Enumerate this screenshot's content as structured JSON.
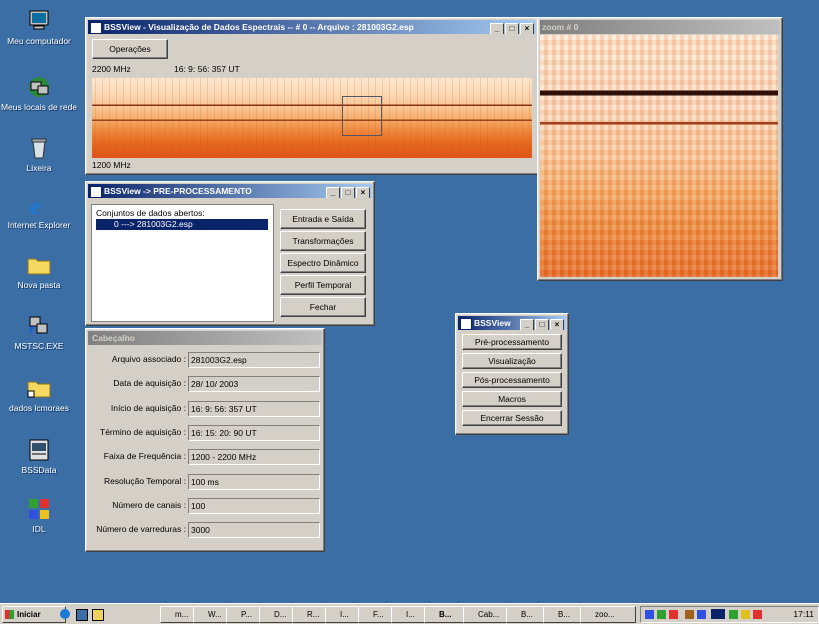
{
  "desktop": {
    "icons": [
      {
        "label": "Meu computador",
        "icon": "my-computer-icon"
      },
      {
        "label": "Meus locais de rede",
        "icon": "network-places-icon"
      },
      {
        "label": "Lixeira",
        "icon": "recycle-bin-icon"
      },
      {
        "label": "Internet Explorer",
        "icon": "internet-explorer-icon"
      },
      {
        "label": "Nova pasta",
        "icon": "folder-icon"
      },
      {
        "label": "MSTSC.EXE",
        "icon": "mstsc-icon"
      },
      {
        "label": "dados lcmoraes",
        "icon": "folder-shortcut-icon"
      },
      {
        "label": "BSSData",
        "icon": "bssdata-icon"
      },
      {
        "label": "IDL",
        "icon": "idl-icon"
      }
    ]
  },
  "main_window": {
    "title": "BSSView - Visualização de Dados Espectrais -- # 0  --  Arquivo : 281003G2.esp",
    "operations_label": "Operações",
    "freq_top": "2200 MHz",
    "time_label": "16: 9: 56: 357 UT",
    "freq_bottom": "1200 MHz"
  },
  "zoom_window": {
    "title": "zoom # 0"
  },
  "pre_window": {
    "title": "BSSView -> PRE-PROCESSAMENTO",
    "list_label": "Conjuntos de dados abertos:",
    "list_items": [
      "0 ---> 281003G2.esp"
    ],
    "buttons": [
      "Entrada e Saída",
      "Transformações",
      "Espectro Dinâmico",
      "Perfil Temporal",
      "Fechar"
    ]
  },
  "header_window": {
    "title": "Cabeçalho",
    "fields": [
      {
        "label": "Arquivo associado :",
        "value": "281003G2.esp"
      },
      {
        "label": "Data de aquisição :",
        "value": "28/ 10/ 2003"
      },
      {
        "label": "Início de aquisição :",
        "value": "16: 9: 56: 357  UT"
      },
      {
        "label": "Término de aquisição :",
        "value": "16: 15: 20: 90  UT"
      },
      {
        "label": "Faixa de Frequência :",
        "value": "1200 - 2200 MHz"
      },
      {
        "label": "Resolução Temporal :",
        "value": "100 ms"
      },
      {
        "label": "Número de canais :",
        "value": "100"
      },
      {
        "label": "Número de varreduras :",
        "value": "3000"
      }
    ]
  },
  "bss_window": {
    "title": "BSSView",
    "buttons": [
      "Pré-processamento",
      "Visualização",
      "Pós-processamento",
      "Macros",
      "Encerrar Sessão"
    ]
  },
  "taskbar": {
    "start_label": "Iniciar",
    "items": [
      "m...",
      "W...",
      "P...",
      "D...",
      "R...",
      "I...",
      "F...",
      "I...",
      "B...",
      "Cab...",
      "B...",
      "B...",
      "zoo..."
    ],
    "clock": "17:11"
  },
  "colors": {
    "desktop": "#3a6ea5",
    "active_title": "#0a246a",
    "spectrum_light": "#fde6c8",
    "spectrum_dark": "#e0541a"
  }
}
